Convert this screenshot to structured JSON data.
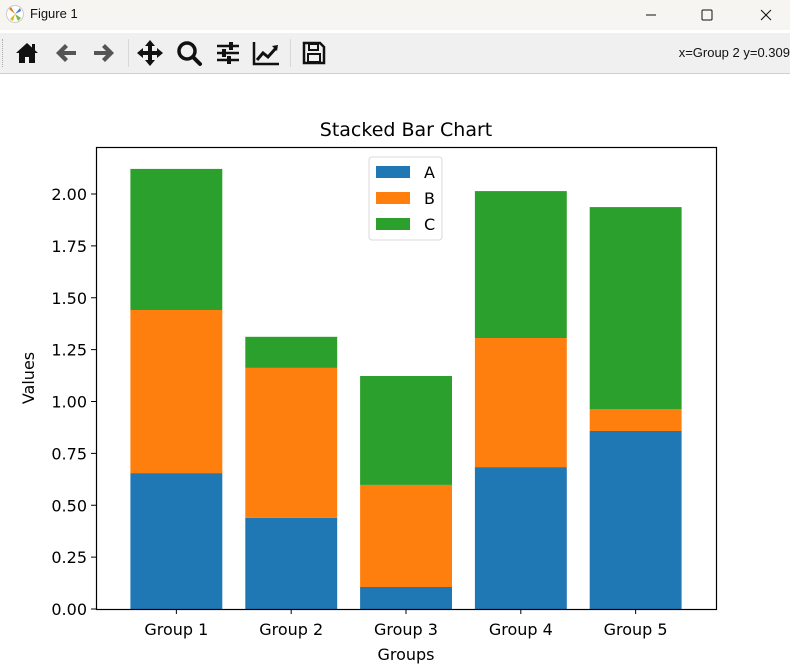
{
  "window": {
    "title": "Figure 1",
    "controls": [
      "minimize",
      "maximize",
      "close"
    ]
  },
  "toolbar": {
    "buttons": [
      {
        "name": "home",
        "icon": "home-icon"
      },
      {
        "name": "back",
        "icon": "arrow-left-icon"
      },
      {
        "name": "forward",
        "icon": "arrow-right-icon"
      },
      {
        "name": "pan",
        "icon": "move-icon"
      },
      {
        "name": "zoom",
        "icon": "magnifier-icon"
      },
      {
        "name": "configure-subplots",
        "icon": "sliders-icon"
      },
      {
        "name": "edit-axis",
        "icon": "line-chart-icon"
      },
      {
        "name": "save",
        "icon": "floppy-disk-icon"
      }
    ],
    "coords_text": "x=Group 2 y=0.309"
  },
  "colors": {
    "A": "#1f77b4",
    "B": "#ff7f0e",
    "C": "#2ca02c"
  },
  "chart_data": {
    "type": "bar",
    "stacked": true,
    "title": "Stacked Bar Chart",
    "xlabel": "Groups",
    "ylabel": "Values",
    "categories": [
      "Group 1",
      "Group 2",
      "Group 3",
      "Group 4",
      "Group 5"
    ],
    "series": [
      {
        "name": "A",
        "color": "#1f77b4",
        "values": [
          0.655,
          0.439,
          0.106,
          0.684,
          0.858
        ]
      },
      {
        "name": "B",
        "color": "#ff7f0e",
        "values": [
          0.786,
          0.723,
          0.492,
          0.622,
          0.106
        ]
      },
      {
        "name": "C",
        "color": "#2ca02c",
        "values": [
          0.68,
          0.15,
          0.525,
          0.708,
          0.973
        ]
      }
    ],
    "ylim": [
      0,
      2.225
    ],
    "yticks": [
      "0.00",
      "0.25",
      "0.50",
      "0.75",
      "1.00",
      "1.25",
      "1.50",
      "1.75",
      "2.00"
    ],
    "ytick_values": [
      0,
      0.25,
      0.5,
      0.75,
      1.0,
      1.25,
      1.5,
      1.75,
      2.0
    ],
    "grid": false,
    "legend": {
      "placement": "upper-center",
      "entries": [
        "A",
        "B",
        "C"
      ]
    }
  }
}
